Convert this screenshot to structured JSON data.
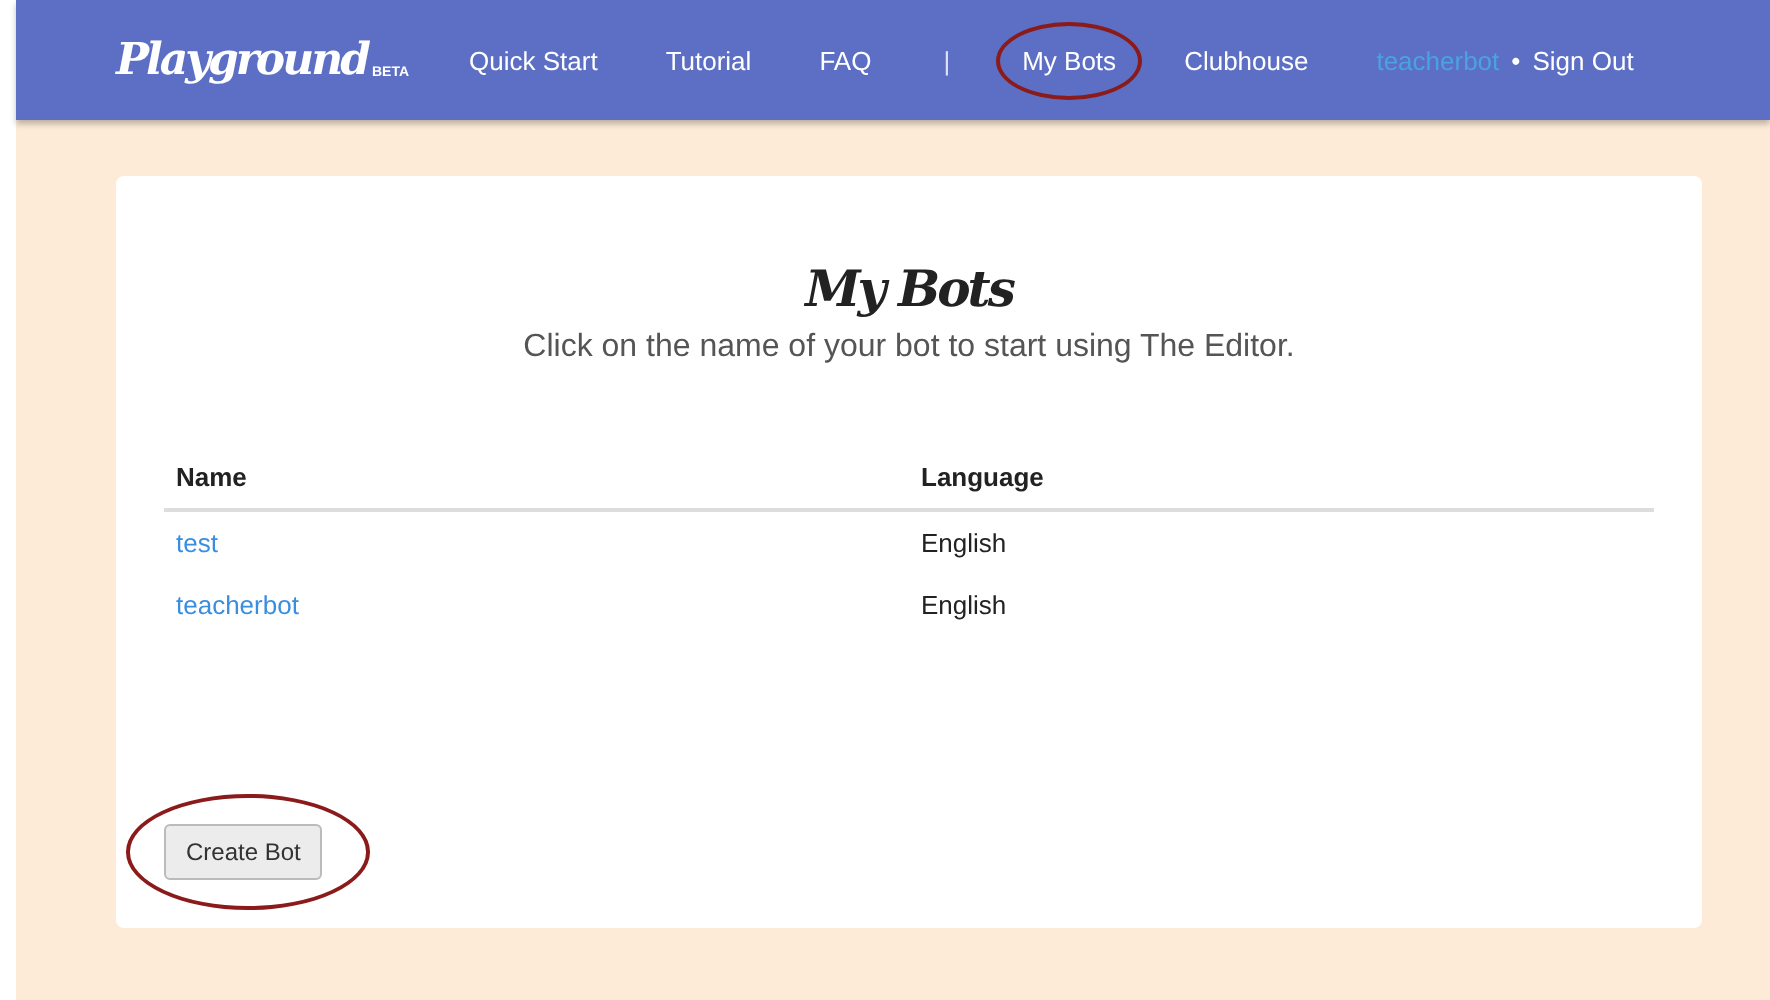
{
  "header": {
    "logo": "Playground",
    "logo_badge": "BETA",
    "nav": [
      {
        "kind": "link",
        "label": "Quick Start",
        "circled": false
      },
      {
        "kind": "link",
        "label": "Tutorial",
        "circled": false
      },
      {
        "kind": "link",
        "label": "FAQ",
        "circled": false
      },
      {
        "kind": "divider",
        "label": "|",
        "circled": false
      },
      {
        "kind": "link",
        "label": "My Bots",
        "circled": true
      },
      {
        "kind": "link",
        "label": "Clubhouse",
        "circled": false
      }
    ],
    "user": {
      "name": "teacherbot",
      "separator": "•",
      "sign_out": "Sign Out"
    }
  },
  "page": {
    "title": "My Bots",
    "subtitle": "Click on the name of your bot to start using The Editor.",
    "table": {
      "columns": [
        "Name",
        "Language"
      ],
      "rows": [
        {
          "name": "test",
          "language": "English"
        },
        {
          "name": "teacherbot",
          "language": "English"
        }
      ]
    },
    "create_button": {
      "label": "Create Bot",
      "circled": true
    }
  }
}
